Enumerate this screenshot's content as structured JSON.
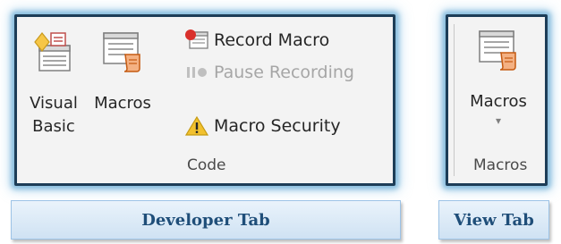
{
  "developer_panel": {
    "visual_basic": {
      "line1": "Visual",
      "line2": "Basic"
    },
    "macros_label": "Macros",
    "record_macro": "Record Macro",
    "pause_recording": "Pause Recording",
    "macro_security": "Macro Security",
    "group_label": "Code"
  },
  "view_panel": {
    "macros_label": "Macros",
    "dropdown_arrow": "▾",
    "group_label": "Macros"
  },
  "captions": {
    "developer": "Developer Tab",
    "view": "View Tab"
  },
  "colors": {
    "panel_border": "#1d3d57",
    "caption_text": "#1f4e79",
    "record_icon_red": "#d9302c",
    "warning_yellow": "#f2c12e"
  }
}
